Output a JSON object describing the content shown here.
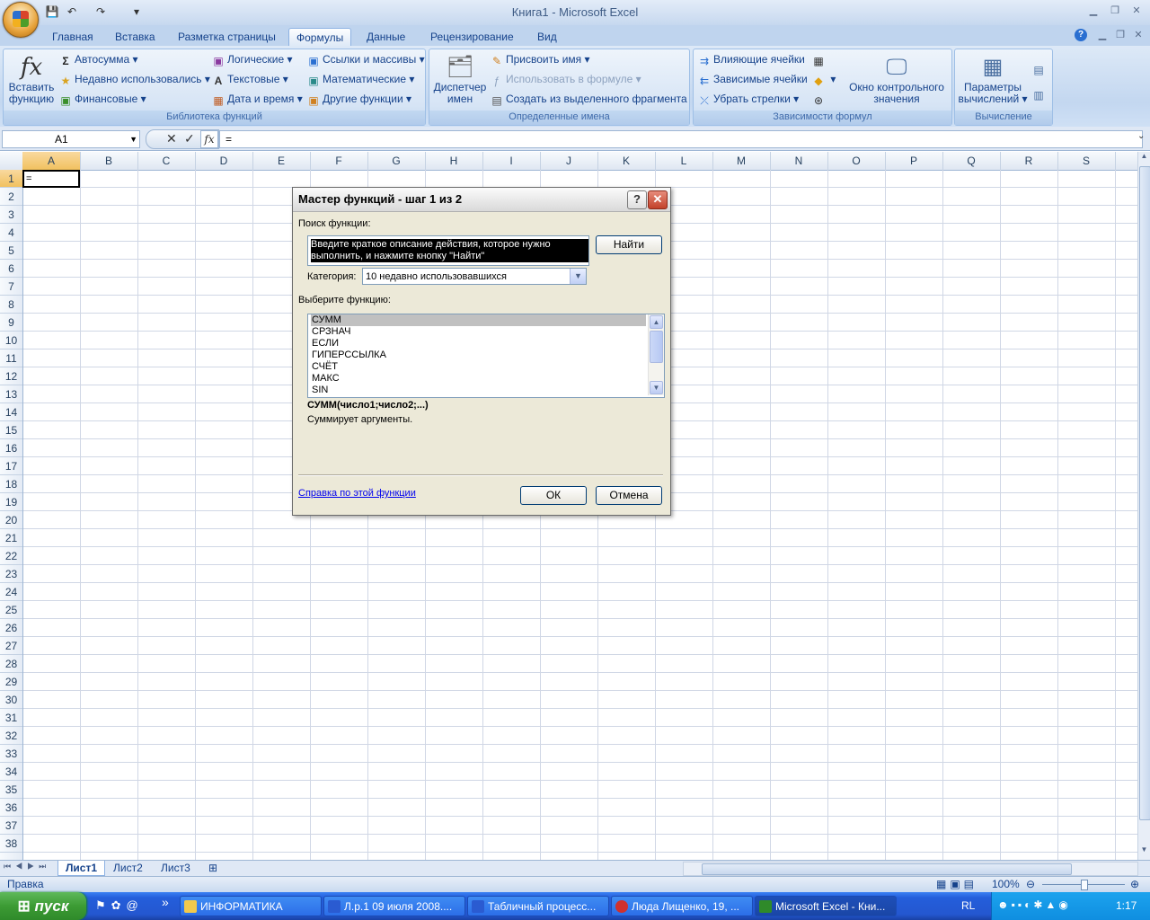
{
  "window": {
    "title": "Книга1 - Microsoft Excel"
  },
  "quick_access": {
    "save": "💾",
    "undo": "↶",
    "redo": "↷",
    "customize": "▾"
  },
  "tabs": [
    "Главная",
    "Вставка",
    "Разметка страницы",
    "Формулы",
    "Данные",
    "Рецензирование",
    "Вид"
  ],
  "active_tab": "Формулы",
  "ribbon": {
    "insert_function": {
      "label1": "Вставить",
      "label2": "функцию"
    },
    "lib": {
      "autosum": "Автосумма",
      "recent": "Недавно использовались",
      "financial": "Финансовые",
      "logical": "Логические",
      "text": "Текстовые",
      "datetime": "Дата и время",
      "lookup": "Ссылки и массивы",
      "math": "Математические",
      "other": "Другие функции",
      "group_label": "Библиотека функций"
    },
    "names": {
      "manager1": "Диспетчер",
      "manager2": "имен",
      "define": "Присвоить имя",
      "use": "Использовать в формуле",
      "create": "Создать из выделенного фрагмента",
      "group_label": "Определенные имена"
    },
    "audit": {
      "precedents": "Влияющие ячейки",
      "dependents": "Зависимые ячейки",
      "remove": "Убрать стрелки",
      "watch1": "Окно контрольного",
      "watch2": "значения",
      "group_label": "Зависимости формул"
    },
    "calc": {
      "options1": "Параметры",
      "options2": "вычислений",
      "group_label": "Вычисление"
    }
  },
  "formula_bar": {
    "name_box": "A1",
    "formula": "="
  },
  "columns": [
    "A",
    "B",
    "C",
    "D",
    "E",
    "F",
    "G",
    "H",
    "I",
    "J",
    "K",
    "L",
    "M",
    "N",
    "O",
    "P",
    "Q",
    "R",
    "S"
  ],
  "rows": [
    "1",
    "2",
    "3",
    "4",
    "5",
    "6",
    "7",
    "8",
    "9",
    "10",
    "11",
    "12",
    "13",
    "14",
    "15",
    "16",
    "17",
    "18",
    "19",
    "20",
    "21",
    "22",
    "23",
    "24",
    "25",
    "26",
    "27",
    "28",
    "29",
    "30",
    "31",
    "32",
    "33",
    "34",
    "35",
    "36",
    "37",
    "38"
  ],
  "active_cell_value": "=",
  "sheets": [
    "Лист1",
    "Лист2",
    "Лист3"
  ],
  "status": {
    "mode": "Правка",
    "zoom": "100%"
  },
  "dialog": {
    "title": "Мастер функций - шаг 1 из 2",
    "search_label": "Поиск функции:",
    "search_value": "Введите краткое описание действия, которое нужно выполнить, и нажмите кнопку \"Найти\"",
    "find_button": "Найти",
    "category_label": "Категория:",
    "category_value": "10 недавно использовавшихся",
    "select_label": "Выберите функцию:",
    "functions": [
      "СУММ",
      "СРЗНАЧ",
      "ЕСЛИ",
      "ГИПЕРССЫЛКА",
      "СЧЁТ",
      "МАКС",
      "SIN"
    ],
    "selected_function": "СУММ",
    "signature": "СУММ(число1;число2;...)",
    "description": "Суммирует аргументы.",
    "help_link": "Справка по этой функции",
    "ok": "ОК",
    "cancel": "Отмена"
  },
  "taskbar": {
    "start": "пуск",
    "items": [
      "ИНФОРМАТИКА",
      "Л.р.1 09 июля 2008....",
      "Табличный процесс...",
      "Люда Лищенко, 19, ...",
      "Microsoft Excel - Кни..."
    ],
    "lang": "RL",
    "clock": "1:17"
  }
}
